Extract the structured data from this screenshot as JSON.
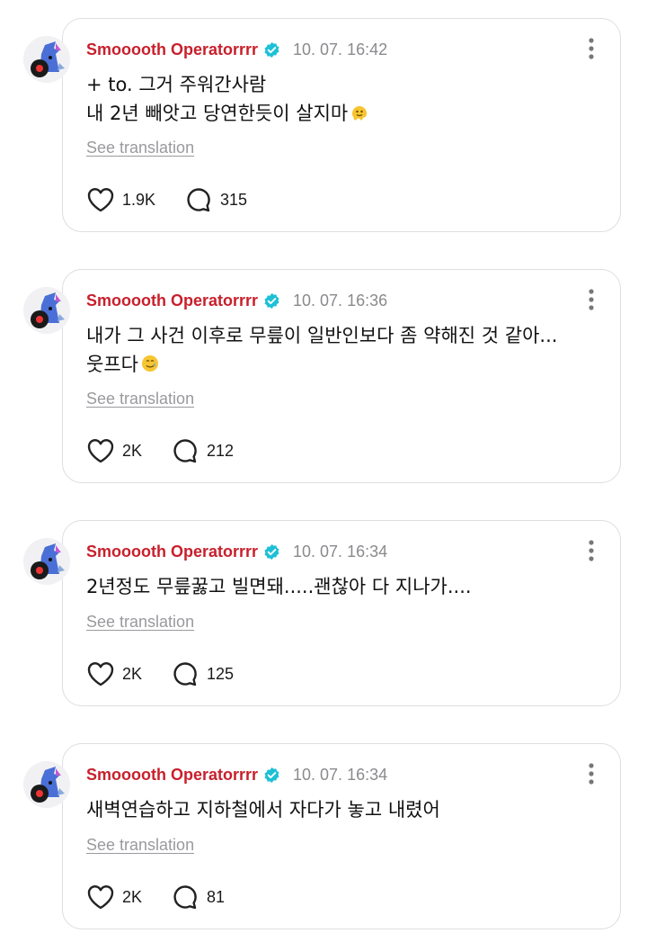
{
  "posts": [
    {
      "username": "Smooooth Operatorrrr",
      "time": "10. 07. 16:42",
      "text": "+ to. 그거 주워간사람\n내 2년 빼앗고 당연한듯이 살지마",
      "emoji": "melting-face-emoji",
      "translate": "See translation",
      "likes": "1.9K",
      "replies": "315"
    },
    {
      "username": "Smooooth Operatorrrr",
      "time": "10. 07. 16:36",
      "text": "내가 그 사건 이후로 무릎이 일반인보다 좀 약해진 것 같아...\n웃프다",
      "emoji": "smiling-face-with-tear-emoji",
      "translate": "See translation",
      "likes": "2K",
      "replies": "212"
    },
    {
      "username": "Smooooth Operatorrrr",
      "time": "10. 07. 16:34",
      "text": "2년정도 무릎꿇고 빌면돼.....괜찮아 다 지나가....",
      "emoji": "",
      "translate": "See translation",
      "likes": "2K",
      "replies": "125"
    },
    {
      "username": "Smooooth Operatorrrr",
      "time": "10. 07. 16:34",
      "text": "새벽연습하고 지하철에서 자다가 놓고 내렸어",
      "emoji": "",
      "translate": "See translation",
      "likes": "2K",
      "replies": "81"
    }
  ],
  "colors": {
    "username": "#c8202c",
    "verified": "#1dc0d6",
    "muted": "#8a8a8e"
  },
  "icons": [
    "verified-badge-icon",
    "more-options-icon",
    "heart-icon",
    "comment-icon"
  ]
}
